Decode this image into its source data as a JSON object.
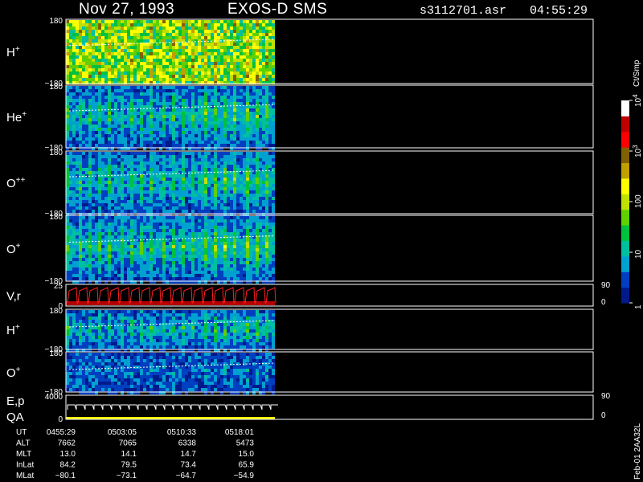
{
  "header": {
    "date": "Nov 27, 1993",
    "instrument": "EXOS-D SMS",
    "file": "s3112701.asr",
    "time": "04:55:29"
  },
  "colors": {
    "frame": "#ffffff",
    "band": [
      "#001a8c",
      "#003fbf",
      "#00a0d0",
      "#00c0a0",
      "#00c040",
      "#60d000",
      "#c0e000",
      "#ffff00",
      "#c0a000",
      "#806000",
      "#ff0000",
      "#c00000",
      "#ffffff"
    ],
    "trace_white": "#ffffff",
    "trace_red": "#ff2020",
    "qa_bar": "#ffff00"
  },
  "panels": [
    {
      "id": "H+",
      "label": "H",
      "sup": "+",
      "ymax": "180",
      "ymin": "−180",
      "intensity": 0.85
    },
    {
      "id": "He+",
      "label": "He",
      "sup": "+",
      "ymax": "180",
      "ymin": "−180",
      "intensity": 0.45
    },
    {
      "id": "O++",
      "label": "O",
      "sup": "++",
      "ymax": "180",
      "ymin": "−180",
      "intensity": 0.45
    },
    {
      "id": "O+",
      "label": "O",
      "sup": "+",
      "ymax": "180",
      "ymin": "−180",
      "intensity": 0.5
    },
    {
      "id": "Vr",
      "label": "V,r",
      "sup": "",
      "ymax": "25",
      "ymin": "0",
      "right_max": "90",
      "right_min": "0",
      "kind": "trace"
    },
    {
      "id": "H+2",
      "label": "H",
      "sup": "+",
      "ymax": "180",
      "ymin": "−180",
      "intensity": 0.4
    },
    {
      "id": "O+2",
      "label": "O",
      "sup": "+",
      "ymax": "180",
      "ymin": "−180",
      "intensity": 0.15
    },
    {
      "id": "Ep",
      "label": "E,p",
      "sup": "",
      "label2": "QA",
      "ymax": "4000",
      "ymin": "0",
      "right_max": "90",
      "right_min": "0",
      "kind": "steps"
    }
  ],
  "colorbar": {
    "unit": "Ct/Smp",
    "ticks": [
      {
        "label": "10",
        "sup": "4",
        "level": 4
      },
      {
        "label": "10",
        "sup": "3",
        "level": 3
      },
      {
        "label": "100",
        "sup": "",
        "level": 2
      },
      {
        "label": "10",
        "sup": "",
        "level": 1
      },
      {
        "label": "1",
        "sup": "",
        "level": 0
      }
    ]
  },
  "footer": {
    "rows": [
      {
        "name": "UT",
        "values": [
          "0455:29",
          "0503:05",
          "0510:33",
          "0518:01"
        ]
      },
      {
        "name": "ALT",
        "values": [
          "7662",
          "7065",
          "6338",
          "5473"
        ]
      },
      {
        "name": "MLT",
        "values": [
          "13.0",
          "14.1",
          "14.7",
          "15.0"
        ]
      },
      {
        "name": "InLat",
        "values": [
          "84.2",
          "79.5",
          "73.4",
          "65.9"
        ]
      },
      {
        "name": "MLat",
        "values": [
          "−80.1",
          "−73.1",
          "−64.7",
          "−54.9"
        ]
      }
    ],
    "stamp": "Feb-01 2AA32L"
  },
  "chart_data": {
    "type": "heatmap",
    "title": "Nov 27, 1993   EXOS-D SMS",
    "panels": [
      "H+",
      "He+",
      "O++",
      "O+",
      "V,r",
      "H+",
      "O+",
      "E,p"
    ],
    "x_ticks": [
      "0455:29",
      "0503:05",
      "0510:33",
      "0518:01"
    ],
    "y_range": [
      -180,
      180
    ],
    "data_fraction": 0.36,
    "color_scale": "log",
    "color_range": [
      1,
      10000
    ]
  }
}
